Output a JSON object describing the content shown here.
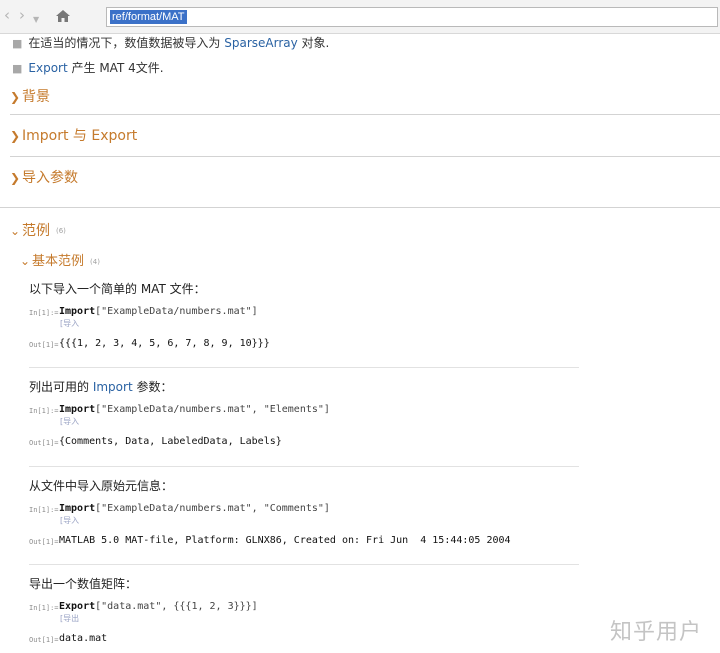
{
  "address_bar": {
    "url": "ref/format/MAT"
  },
  "bullets": [
    {
      "text_before": "在适当的情况下，数值数据被导入为 ",
      "link": "SparseArray",
      "text_after": " 对象."
    },
    {
      "text_before": "",
      "link": "Export",
      "text_after": " 产生 MAT 4文件."
    }
  ],
  "sections": {
    "background": "背景",
    "import_export": "Import 与 Export",
    "import_params": "导入参数",
    "examples": {
      "label": "范例",
      "count": "(6)"
    }
  },
  "basic_examples": {
    "label": "基本范例",
    "count": "(4)",
    "items": [
      {
        "title": "以下导入一个简单的 MAT 文件：",
        "in_label": "In[1]:=",
        "code_fn": "Import",
        "code_args": "[\"ExampleData/numbers.mat\"]",
        "tag": "[导入",
        "out_label": "Out[1]=",
        "output": "{{{1, 2, 3, 4, 5, 6, 7, 8, 9, 10}}}"
      },
      {
        "title_before": "列出可用的 ",
        "title_link": "Import",
        "title_after": " 参数：",
        "in_label": "In[1]:=",
        "code_fn": "Import",
        "code_args": "[\"ExampleData/numbers.mat\", \"Elements\"]",
        "tag": "[导入",
        "out_label": "Out[1]=",
        "output": "{Comments, Data, LabeledData, Labels}"
      },
      {
        "title": "从文件中导入原始元信息：",
        "in_label": "In[1]:=",
        "code_fn": "Import",
        "code_args": "[\"ExampleData/numbers.mat\", \"Comments\"]",
        "tag": "[导入",
        "out_label": "Out[1]=",
        "output": "MATLAB 5.0 MAT-file, Platform: GLNX86, Created on: Fri Jun  4 15:44:05 2004"
      },
      {
        "title": "导出一个数值矩阵：",
        "in_label": "In[1]:=",
        "code_fn": "Export",
        "code_args": "[\"data.mat\", {{{1, 2, 3}}}]",
        "tag": "[导出",
        "out_label": "Out[1]=",
        "output": "data.mat"
      }
    ]
  },
  "watermark": "知乎用户",
  "colors": {
    "section": "#c57a2c",
    "link": "#2a62a3",
    "selection": "#3b71c8"
  }
}
